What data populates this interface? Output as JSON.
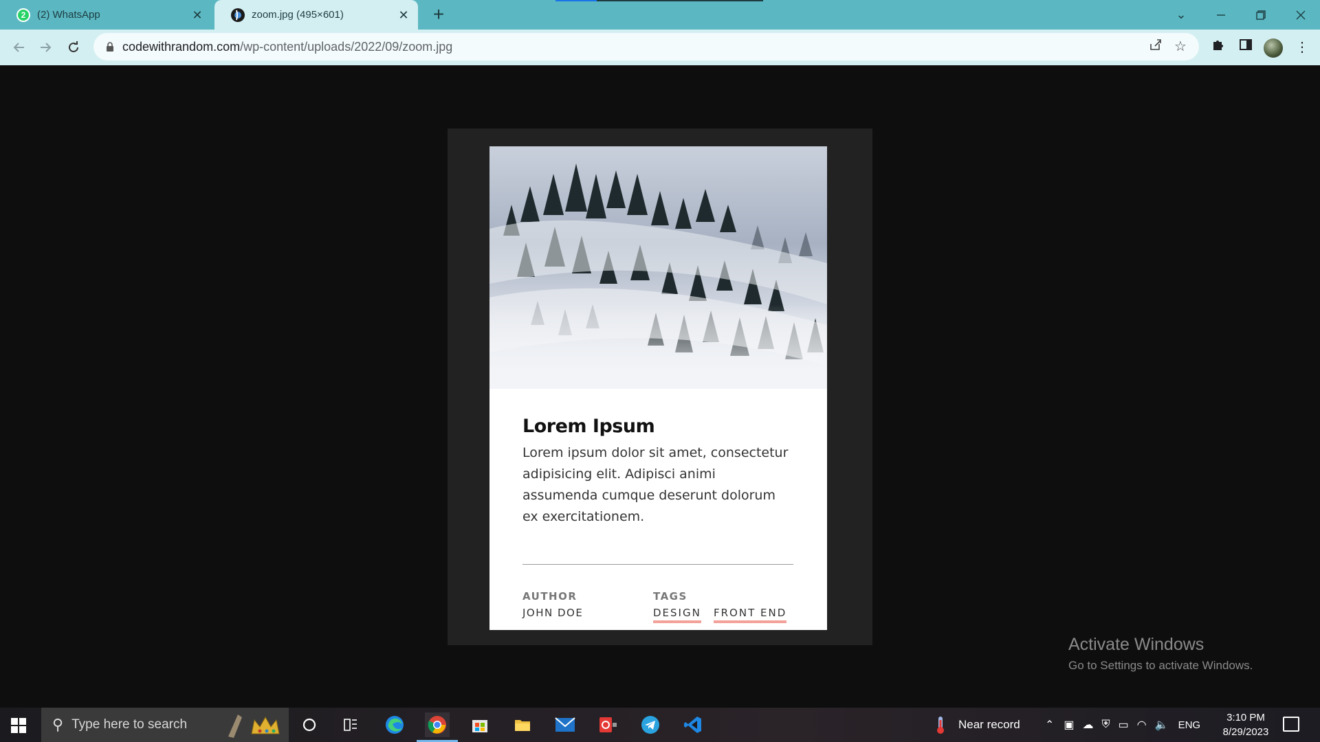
{
  "browser": {
    "tabs": [
      {
        "title": "(2) WhatsApp",
        "favicon": "whatsapp-icon",
        "badge": "2",
        "active": false
      },
      {
        "title": "zoom.jpg (495×601)",
        "favicon": "image-globe-icon",
        "active": true
      }
    ],
    "url_host": "codewithrandom.com",
    "url_path": "/wp-content/uploads/2022/09/zoom.jpg",
    "theme_color": "#5bb8c2"
  },
  "card": {
    "title": "Lorem Ipsum",
    "description": "Lorem ipsum dolor sit amet, consectetur adipisicing elit. Adipisci animi assumenda cumque deserunt dolorum ex exercitationem.",
    "author_label": "AUTHOR",
    "author_name": "JOHN DOE",
    "tags_label": "TAGS",
    "tags": [
      "DESIGN",
      "FRONT END"
    ],
    "tag_underline_color": "#f3a29a"
  },
  "watermark": {
    "line1": "Activate Windows",
    "line2": "Go to Settings to activate Windows."
  },
  "taskbar": {
    "search_placeholder": "Type here to search",
    "weather_text": "Near record",
    "language": "ENG",
    "time": "3:10 PM",
    "date": "8/29/2023",
    "apps": [
      "cortana-icon",
      "task-view-icon",
      "edge-icon",
      "chrome-icon",
      "store-icon",
      "file-explorer-icon",
      "mail-icon",
      "screen-recorder-icon",
      "telegram-icon",
      "vscode-icon"
    ]
  }
}
